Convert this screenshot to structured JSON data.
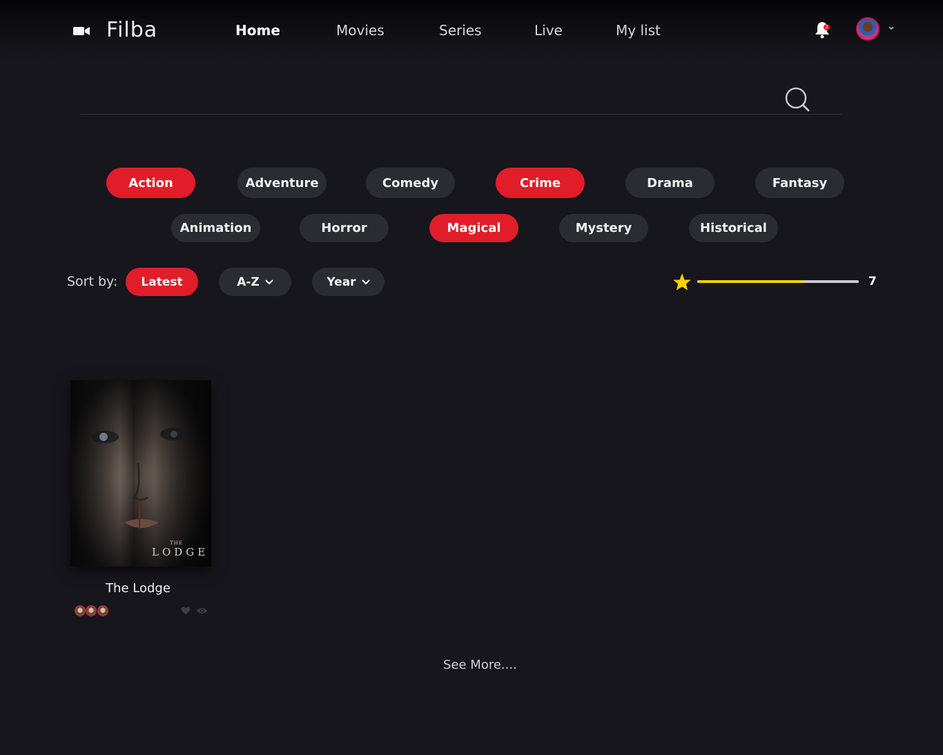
{
  "app": {
    "name": "Filba"
  },
  "nav": [
    "Home",
    "Movies",
    "Series",
    "Live",
    "My list"
  ],
  "notifications": {
    "count": "2"
  },
  "search": {
    "placeholder": ""
  },
  "genres": [
    {
      "label": "Action",
      "selected": true
    },
    {
      "label": "Adventure",
      "selected": false
    },
    {
      "label": "Comedy",
      "selected": false
    },
    {
      "label": "Crime",
      "selected": true
    },
    {
      "label": "Drama",
      "selected": false
    },
    {
      "label": "Fantasy",
      "selected": false
    },
    {
      "label": "Animation",
      "selected": false
    },
    {
      "label": "Horror",
      "selected": false
    },
    {
      "label": "Magical",
      "selected": true
    },
    {
      "label": "Mystery",
      "selected": false
    },
    {
      "label": "Historical",
      "selected": false
    }
  ],
  "sort": {
    "label": "Sort by:",
    "options": [
      {
        "label": "Latest",
        "selected": true
      },
      {
        "label": "A-Z",
        "selected": false,
        "dropdown": true
      },
      {
        "label": "Year",
        "selected": false,
        "dropdown": true
      }
    ]
  },
  "rating_filter": {
    "value": "7",
    "fraction": 0.66
  },
  "movies": [
    {
      "title": "The Lodge",
      "poster_text": "LODGE",
      "poster_small_text": "THE",
      "icons": [
        "heart-icon",
        "eye-icon"
      ]
    }
  ],
  "see_more": "See More....",
  "colors": {
    "accent": "#e11d2a",
    "chip": "#2b2b32",
    "background": "#16161c",
    "star": "#f5d200"
  }
}
